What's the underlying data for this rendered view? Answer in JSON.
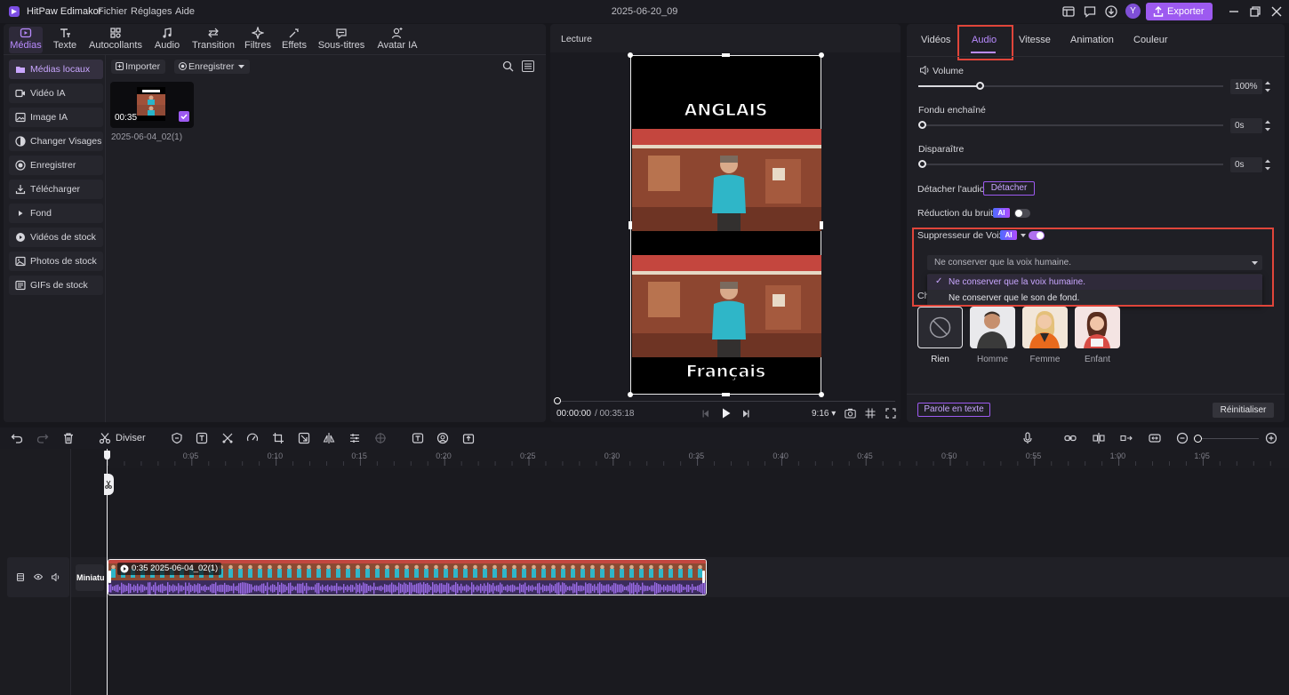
{
  "app": {
    "name": "HitPaw Edimakor",
    "menus": [
      "Fichier",
      "Réglages",
      "Aide"
    ],
    "doc_title": "2025-06-20_09",
    "avatar_letter": "Y",
    "export_label": "Exporter"
  },
  "toolbar_tabs": [
    {
      "label": "Médias",
      "icon": "media-icon",
      "active": true
    },
    {
      "label": "Texte",
      "icon": "text-icon"
    },
    {
      "label": "Autocollants",
      "icon": "sticker-icon"
    },
    {
      "label": "Audio",
      "icon": "music-icon"
    },
    {
      "label": "Transition",
      "icon": "transition-icon"
    },
    {
      "label": "Filtres",
      "icon": "filter-icon"
    },
    {
      "label": "Effets",
      "icon": "effects-icon"
    },
    {
      "label": "Sous-titres",
      "icon": "subtitles-icon"
    },
    {
      "label": "Avatar IA",
      "icon": "avatar-icon"
    }
  ],
  "sidebar": {
    "items": [
      {
        "label": "Médias locaux",
        "icon": "folder-icon",
        "active": true
      },
      {
        "label": "Vidéo IA",
        "icon": "video-icon"
      },
      {
        "label": "Image IA",
        "icon": "image-icon"
      },
      {
        "label": "Changer Visages",
        "icon": "face-icon"
      },
      {
        "label": "Enregistrer",
        "icon": "record-icon"
      },
      {
        "label": "Télécharger",
        "icon": "download-icon"
      },
      {
        "label": "Fond",
        "icon": "play-icon"
      },
      {
        "label": "Vidéos de stock",
        "icon": "stock-video-icon"
      },
      {
        "label": "Photos de stock",
        "icon": "stock-photo-icon"
      },
      {
        "label": "GIFs de stock",
        "icon": "gif-icon"
      }
    ]
  },
  "media": {
    "import_label": "Importer",
    "record_label": "Enregistrer",
    "clip": {
      "duration": "00:35",
      "name": "2025-06-04_02(1)"
    }
  },
  "preview": {
    "header": "Lecture",
    "top_text": "ANGLAIS",
    "bottom_text": "Français",
    "time_current": "00:00:00",
    "time_total": "/ 00:35:18",
    "ratio": "9:16"
  },
  "right_panel": {
    "tabs": [
      "Vidéos",
      "Audio",
      "Vitesse",
      "Animation",
      "Couleur"
    ],
    "active_tab": "Audio",
    "volume": {
      "label": "Volume",
      "value": "100%",
      "level": 0.2
    },
    "fade_in": {
      "label": "Fondu enchaîné",
      "value": "0s"
    },
    "fade_out": {
      "label": "Disparaître",
      "value": "0s"
    },
    "detach": {
      "label": "Détacher l'audio",
      "button": "Détacher"
    },
    "noise": {
      "label": "Réduction du bruit",
      "ai": "AI"
    },
    "voice_suppressor": {
      "label": "Suppresseur de Voix",
      "ai": "AI",
      "selected": "Ne conserver que la voix humaine.",
      "options": [
        "Ne conserver que la voix humaine.",
        "Ne conserver que le son de fond."
      ],
      "hidden_label_fragment": "Cha"
    },
    "voices": [
      "Rien",
      "Homme",
      "Femme",
      "Enfant"
    ],
    "speech_to_text": "Parole en texte",
    "reset": "Réinitialiser"
  },
  "timeline": {
    "split_label": "Diviser",
    "ruler": [
      "0:05",
      "0:10",
      "0:15",
      "0:20",
      "0:25",
      "0:30",
      "0:35",
      "0:40",
      "0:45",
      "0:50",
      "0:55",
      "1:00",
      "1:05"
    ],
    "track_label": "Miniatur",
    "clip_label": "0:35 2025-06-04_02(1)"
  },
  "colors": {
    "accent": "#9d5af0",
    "highlight": "#e0453a"
  }
}
